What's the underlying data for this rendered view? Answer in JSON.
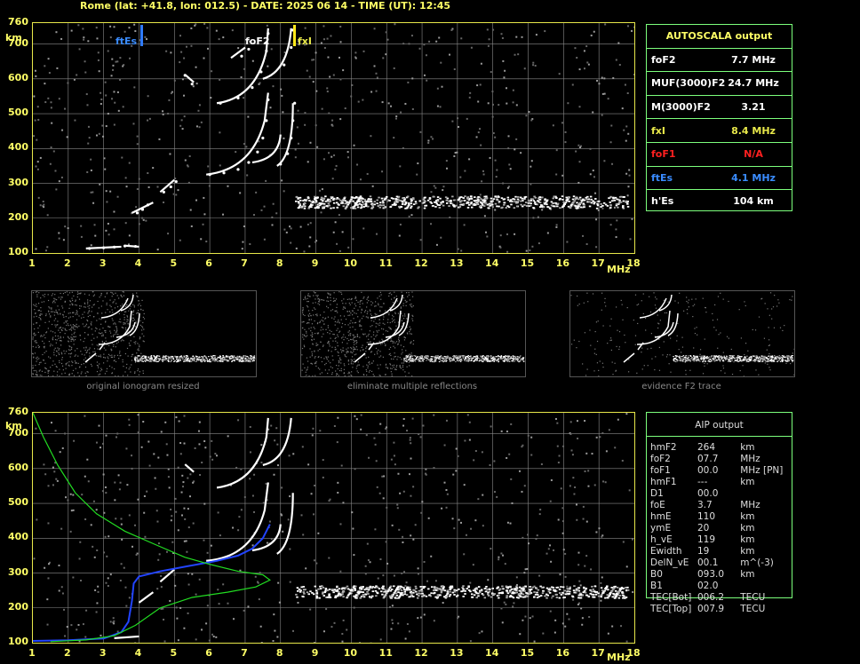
{
  "header": {
    "title": "Rome (lat: +41.8, lon: 012.5) - DATE: 2025 06 14 - TIME (UT): 12:45"
  },
  "axes": {
    "y_unit": "km",
    "x_unit": "MHz",
    "y_ticks": [
      "760",
      "700",
      "600",
      "500",
      "400",
      "300",
      "200",
      "100"
    ],
    "x_ticks": [
      "1",
      "2",
      "3",
      "4",
      "5",
      "6",
      "7",
      "8",
      "9",
      "10",
      "11",
      "12",
      "13",
      "14",
      "15",
      "16",
      "17",
      "18"
    ]
  },
  "markers": {
    "ftEs": "ftEs",
    "foF2": "foF2",
    "fxI": "fxI"
  },
  "autoscala": {
    "title": "AUTOSCALA output",
    "rows": [
      {
        "k": "foF2",
        "v": "7.7 MHz",
        "color": "#ffffff"
      },
      {
        "k": "MUF(3000)F2",
        "v": "24.7 MHz",
        "color": "#ffffff"
      },
      {
        "k": "M(3000)F2",
        "v": "3.21",
        "color": "#ffffff"
      },
      {
        "k": "fxI",
        "v": "8.4 MHz",
        "color": "#e8e84a"
      },
      {
        "k": "foF1",
        "v": "N/A",
        "color": "#ff2020"
      },
      {
        "k": "ftEs",
        "v": "4.1 MHz",
        "color": "#3a8cff"
      },
      {
        "k": "h'Es",
        "v": "104    km",
        "color": "#ffffff"
      }
    ]
  },
  "thumbs": {
    "captions": [
      "original ionogram resized",
      "eliminate multiple reflections",
      "evidence F2 trace"
    ]
  },
  "aip": {
    "title": "AIP output",
    "rows": [
      [
        "hmF2",
        "264",
        "km"
      ],
      [
        "foF2",
        "07.7",
        "MHz"
      ],
      [
        "foF1",
        "00.0",
        "MHz   [PN]"
      ],
      [
        "hmF1",
        "---",
        "km"
      ],
      [
        "D1",
        "00.0",
        ""
      ],
      [
        "foE",
        "3.7",
        "MHz"
      ],
      [
        "hmE",
        "110",
        "km"
      ],
      [
        "ymE",
        "20",
        "km"
      ],
      [
        "h_vE",
        "119",
        "km"
      ],
      [
        "Ewidth",
        "19",
        "km"
      ],
      [
        "DelN_vE",
        "00.1",
        "m^(-3)"
      ],
      [
        "B0",
        "093.0",
        "km"
      ],
      [
        "B1",
        "02.0",
        ""
      ],
      [
        "TEC[Bot]",
        "006.2",
        "TECU"
      ],
      [
        "TEC[Top]",
        "007.9",
        "TECU"
      ]
    ]
  },
  "chart_data": [
    {
      "type": "scatter",
      "title": "",
      "xlabel": "MHz",
      "ylabel": "km",
      "xlim": [
        1,
        18
      ],
      "ylim": [
        100,
        760
      ],
      "grid": true,
      "series": [
        {
          "values": [
            [
              2.6,
              113
            ],
            [
              3.0,
              115
            ],
            [
              3.3,
              117
            ],
            [
              3.6,
              120
            ],
            [
              3.9,
              119
            ],
            [
              3.95,
              215
            ],
            [
              4.1,
              225
            ],
            [
              4.25,
              238
            ],
            [
              4.7,
              275
            ],
            [
              4.9,
              290
            ],
            [
              5.05,
              305
            ],
            [
              6.0,
              325
            ],
            [
              6.4,
              330
            ],
            [
              6.8,
              340
            ],
            [
              7.1,
              360
            ],
            [
              7.35,
              390
            ],
            [
              7.5,
              430
            ],
            [
              7.6,
              480
            ],
            [
              7.65,
              540
            ],
            [
              8.0,
              355
            ],
            [
              8.2,
              385
            ],
            [
              8.3,
              430
            ],
            [
              8.35,
              480
            ],
            [
              8.4,
              530
            ],
            [
              6.3,
              530
            ],
            [
              6.8,
              545
            ],
            [
              7.2,
              575
            ],
            [
              7.45,
              620
            ],
            [
              7.6,
              680
            ],
            [
              7.65,
              730
            ],
            [
              8.1,
              640
            ],
            [
              8.3,
              690
            ],
            [
              8.35,
              740
            ],
            [
              6.9,
              665
            ],
            [
              7.1,
              685
            ],
            [
              5.3,
              610
            ],
            [
              5.5,
              585
            ]
          ]
        },
        {
          "values": [
            [
              8.5,
              245
            ],
            [
              9,
              250
            ],
            [
              10,
              255
            ],
            [
              11,
              250
            ],
            [
              12,
              255
            ],
            [
              13,
              250
            ],
            [
              14,
              248
            ],
            [
              15,
              245
            ],
            [
              16,
              250
            ],
            [
              17,
              252
            ],
            [
              17.8,
              250
            ]
          ]
        }
      ]
    },
    {
      "type": "line",
      "title": "",
      "xlabel": "MHz",
      "ylabel": "km",
      "xlim": [
        1,
        18
      ],
      "ylim": [
        100,
        760
      ],
      "grid": true,
      "series": [
        {
          "values": [
            [
              1.0,
              105
            ],
            [
              2.0,
              107
            ],
            [
              3.0,
              112
            ],
            [
              3.5,
              130
            ],
            [
              3.7,
              160
            ],
            [
              3.8,
              220
            ],
            [
              3.85,
              270
            ],
            [
              4.0,
              290
            ],
            [
              4.6,
              305
            ],
            [
              5.4,
              320
            ],
            [
              6.2,
              335
            ],
            [
              6.8,
              350
            ],
            [
              7.2,
              370
            ],
            [
              7.5,
              400
            ],
            [
              7.7,
              440
            ]
          ]
        },
        {
          "values": [
            [
              1.0,
              760
            ],
            [
              1.3,
              690
            ],
            [
              1.7,
              610
            ],
            [
              2.2,
              530
            ],
            [
              2.8,
              470
            ],
            [
              3.6,
              420
            ],
            [
              4.5,
              380
            ],
            [
              5.3,
              345
            ],
            [
              6.0,
              325
            ],
            [
              6.8,
              305
            ],
            [
              7.5,
              295
            ],
            [
              7.7,
              280
            ],
            [
              7.3,
              260
            ],
            [
              6.5,
              245
            ],
            [
              5.5,
              230
            ],
            [
              4.6,
              200
            ],
            [
              3.9,
              150
            ],
            [
              3.3,
              120
            ],
            [
              2.5,
              108
            ],
            [
              1.5,
              103
            ]
          ]
        }
      ]
    }
  ]
}
